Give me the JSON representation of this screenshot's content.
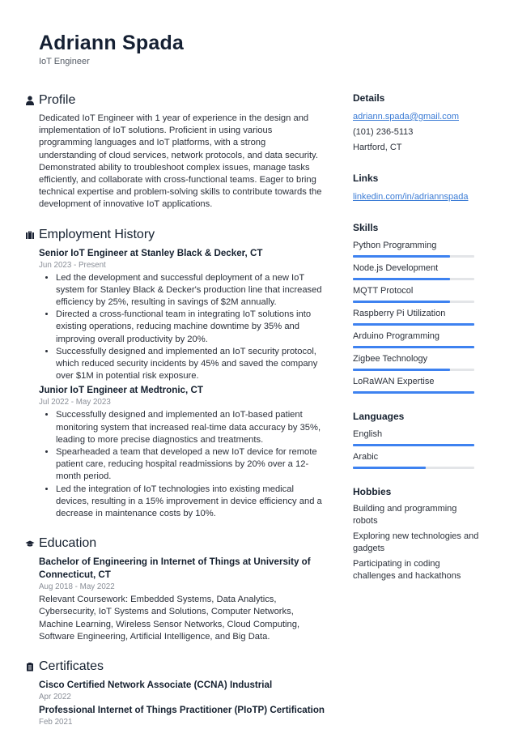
{
  "header": {
    "name": "Adriann Spada",
    "title": "IoT Engineer"
  },
  "profile": {
    "heading": "Profile",
    "icon": "person-icon",
    "text": "Dedicated IoT Engineer with 1 year of experience in the design and implementation of IoT solutions. Proficient in using various programming languages and IoT platforms, with a strong understanding of cloud services, network protocols, and data security. Demonstrated ability to troubleshoot complex issues, manage tasks efficiently, and collaborate with cross-functional teams. Eager to bring technical expertise and problem-solving skills to contribute towards the development of innovative IoT applications."
  },
  "employment": {
    "heading": "Employment History",
    "icon": "briefcase-icon",
    "jobs": [
      {
        "title": "Senior IoT Engineer at Stanley Black & Decker, CT",
        "dates": "Jun 2023 - Present",
        "bullets": [
          "Led the development and successful deployment of a new IoT system for Stanley Black & Decker's production line that increased efficiency by 25%, resulting in savings of $2M annually.",
          "Directed a cross-functional team in integrating IoT solutions into existing operations, reducing machine downtime by 35% and improving overall productivity by 20%.",
          "Successfully designed and implemented an IoT security protocol, which reduced security incidents by 45% and saved the company over $1M in potential risk exposure."
        ]
      },
      {
        "title": "Junior IoT Engineer at Medtronic, CT",
        "dates": "Jul 2022 - May 2023",
        "bullets": [
          "Successfully designed and implemented an IoT-based patient monitoring system that increased real-time data accuracy by 35%, leading to more precise diagnostics and treatments.",
          "Spearheaded a team that developed a new IoT device for remote patient care, reducing hospital readmissions by 20% over a 12-month period.",
          "Led the integration of IoT technologies into existing medical devices, resulting in a 15% improvement in device efficiency and a decrease in maintenance costs by 10%."
        ]
      }
    ]
  },
  "education": {
    "heading": "Education",
    "icon": "graduation-cap-icon",
    "degree": "Bachelor of Engineering in Internet of Things at University of Connecticut, CT",
    "dates": "Aug 2018 - May 2022",
    "coursework": "Relevant Coursework: Embedded Systems, Data Analytics, Cybersecurity, IoT Systems and Solutions, Computer Networks, Machine Learning, Wireless Sensor Networks, Cloud Computing, Software Engineering, Artificial Intelligence, and Big Data."
  },
  "certificates": {
    "heading": "Certificates",
    "icon": "clipboard-icon",
    "items": [
      {
        "name": "Cisco Certified Network Associate (CCNA) Industrial",
        "date": "Apr 2022"
      },
      {
        "name": "Professional Internet of Things Practitioner (PIoTP) Certification",
        "date": "Feb 2021"
      }
    ]
  },
  "details": {
    "heading": "Details",
    "email": "adriann.spada@gmail.com",
    "phone": "(101) 236-5113",
    "location": "Hartford, CT"
  },
  "links": {
    "heading": "Links",
    "items": [
      "linkedin.com/in/adriannspada"
    ]
  },
  "skills": {
    "heading": "Skills",
    "items": [
      {
        "label": "Python Programming",
        "level": 0.8
      },
      {
        "label": "Node.js Development",
        "level": 0.8
      },
      {
        "label": "MQTT Protocol",
        "level": 0.8
      },
      {
        "label": "Raspberry Pi Utilization",
        "level": 1.0
      },
      {
        "label": "Arduino Programming",
        "level": 1.0
      },
      {
        "label": "Zigbee Technology",
        "level": 0.8
      },
      {
        "label": "LoRaWAN Expertise",
        "level": 1.0
      }
    ]
  },
  "languages": {
    "heading": "Languages",
    "items": [
      {
        "label": "English",
        "level": 1.0
      },
      {
        "label": "Arabic",
        "level": 0.6
      }
    ]
  },
  "hobbies": {
    "heading": "Hobbies",
    "items": [
      "Building and programming robots",
      "Exploring new technologies and gadgets",
      "Participating in coding challenges and hackathons"
    ]
  },
  "colors": {
    "accent": "#3e82f0",
    "bar_track": "#e3e5e8",
    "link": "#3a7bd5",
    "muted": "#8a8f98"
  }
}
